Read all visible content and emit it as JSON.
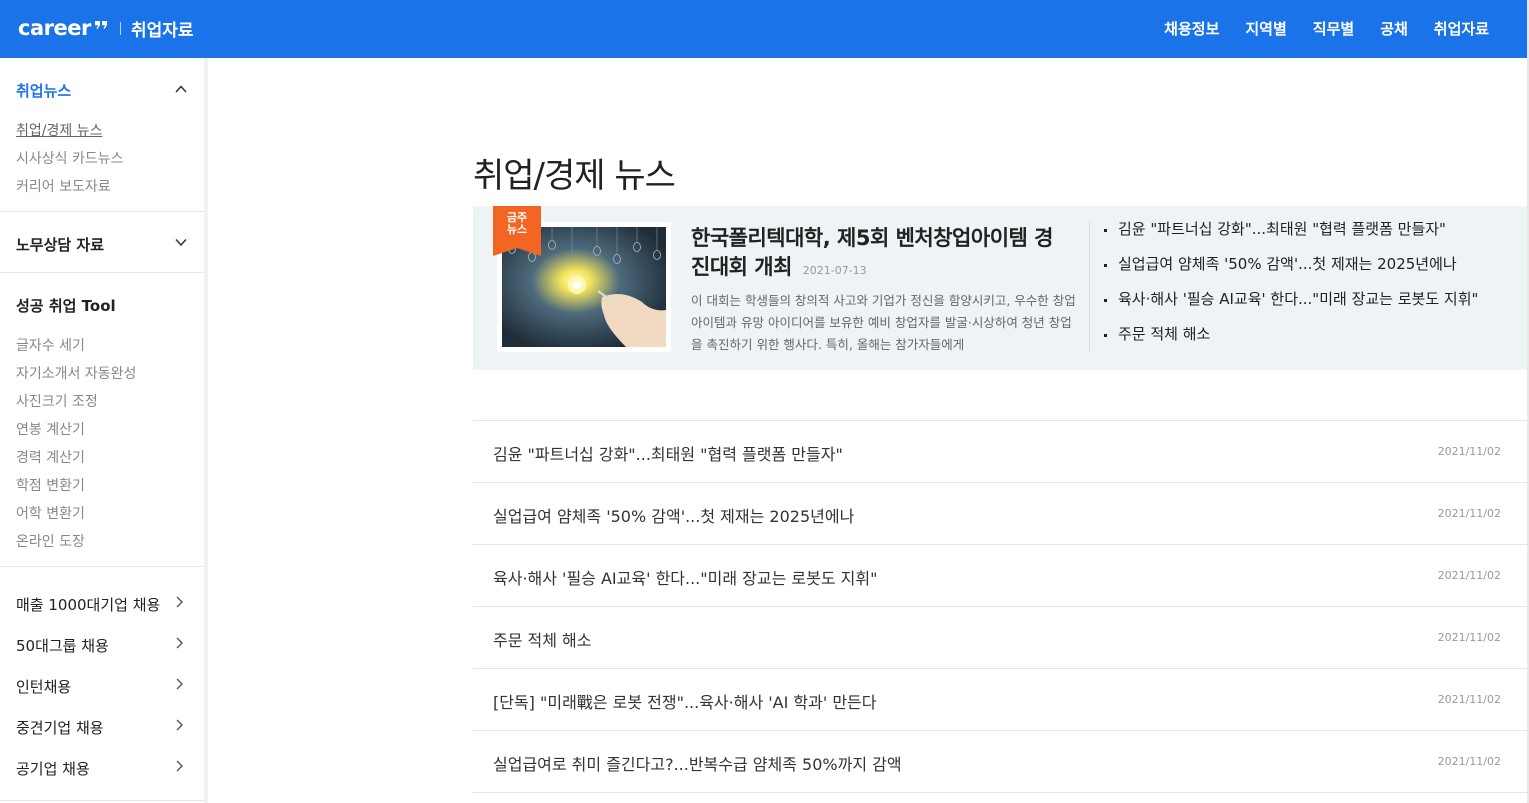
{
  "header": {
    "logo": "career",
    "site_title": "취업자료",
    "nav": [
      "채용정보",
      "지역별",
      "직무별",
      "공채",
      "취업자료"
    ]
  },
  "sidebar": {
    "sections": [
      {
        "title": "취업뉴스",
        "items": [
          "취업/경제 뉴스",
          "시사상식 카드뉴스",
          "커리어 보도자료"
        ]
      },
      {
        "title": "노무상담 자료"
      },
      {
        "title": "성공 취업 Tool",
        "items": [
          "글자수 세기",
          "자기소개서 자동완성",
          "사진크기 조정",
          "연봉 계산기",
          "경력 계산기",
          "학점 변환기",
          "어학 변환기",
          "온라인 도장"
        ]
      }
    ],
    "links": [
      "매출 1000대기업 채용",
      "50대그룹 채용",
      "인턴채용",
      "중견기업 채용",
      "공기업 채용"
    ]
  },
  "main": {
    "page_title": "취업/경제 뉴스",
    "featured": {
      "badge": [
        "금주",
        "뉴스"
      ],
      "title": "한국폴리텍대학, 제5회 벤처창업아이템 경진대회 개최",
      "date": "2021-07-13",
      "body": "이 대회는 학생들의 창의적 사고와 기업가 정신을 함양시키고, 우수한 창업 아이템과 유망 아이디어를 보유한 예비 창업자를 발굴·시상하여 청년 창업을 촉진하기 위한 행사다. 특히, 올해는 참가자들에게",
      "side_news": [
        "김윤 \"파트너십 강화\"...최태원 \"협력 플랫폼 만들자\"",
        "실업급여 얌체족 '50% 감액'...첫 제재는 2025년에나",
        "육사·해사 '필승 AI교육' 한다...\"미래 장교는 로봇도 지휘\"",
        "주문 적체 해소"
      ]
    },
    "news": [
      {
        "title": "김윤 \"파트너십 강화\"...최태원 \"협력 플랫폼 만들자\"",
        "date": "2021/11/02"
      },
      {
        "title": "실업급여 얌체족 '50% 감액'...첫 제재는 2025년에나",
        "date": "2021/11/02"
      },
      {
        "title": "육사·해사 '필승 AI교육' 한다...\"미래 장교는 로봇도 지휘\"",
        "date": "2021/11/02"
      },
      {
        "title": "주문 적체 해소",
        "date": "2021/11/02"
      },
      {
        "title": "[단독] \"미래戰은 로봇 전쟁\"...육사·해사 'AI 학과' 만든다",
        "date": "2021/11/02"
      },
      {
        "title": "실업급여로 취미 즐긴다고?...반복수급 얌체족 50%까지 감액",
        "date": "2021/11/02"
      }
    ]
  },
  "colors": {
    "brand": "#1a73e8",
    "badge": "#f26522",
    "featured_bg": "#eef3f6"
  },
  "icons": [
    "logo-mark-icon",
    "chevron-up-icon",
    "chevron-down-icon",
    "chevron-right-icon"
  ]
}
